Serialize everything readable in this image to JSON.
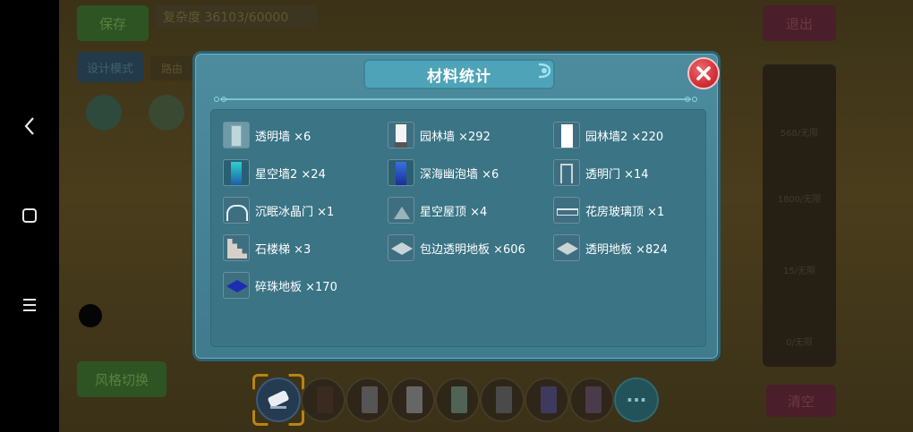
{
  "background": {
    "save_label": "保存",
    "complexity_text": "复杂度 36103/60000",
    "design_mode_label": "设计模式",
    "path_label": "路由",
    "exit_label": "退出",
    "clear_label": "清空",
    "switch_label": "风格切换",
    "right_panel_labels": [
      "568/无限",
      "1800/无限",
      "15/无限",
      "0/无限"
    ]
  },
  "modal": {
    "title": "材料统计",
    "items": [
      {
        "label": "透明墙 ×6",
        "icon": "transparent-wall-icon"
      },
      {
        "label": "园林墙 ×292",
        "icon": "garden-wall-icon"
      },
      {
        "label": "园林墙2 ×220",
        "icon": "garden-wall2-icon"
      },
      {
        "label": "星空墙2 ×24",
        "icon": "starry-wall-icon"
      },
      {
        "label": "深海幽泡墙 ×6",
        "icon": "deepsea-bubble-wall-icon"
      },
      {
        "label": "透明门 ×14",
        "icon": "transparent-door-icon"
      },
      {
        "label": "沉眠冰晶门 ×1",
        "icon": "ice-crystal-door-icon"
      },
      {
        "label": "星空屋顶 ×4",
        "icon": "starry-roof-icon"
      },
      {
        "label": "花房玻璃顶 ×1",
        "icon": "greenhouse-glass-roof-icon"
      },
      {
        "label": "石楼梯 ×3",
        "icon": "stone-stairs-icon"
      },
      {
        "label": "包边透明地板 ×606",
        "icon": "edged-transparent-floor-icon"
      },
      {
        "label": "透明地板 ×824",
        "icon": "transparent-floor-icon"
      },
      {
        "label": "碎珠地板 ×170",
        "icon": "pearl-floor-icon"
      }
    ]
  },
  "colors": {
    "modal_bg": "#4a8799",
    "panel_bg": "#3a7485",
    "title_banner": "#4fa3b8",
    "close_button": "#d3303a"
  }
}
